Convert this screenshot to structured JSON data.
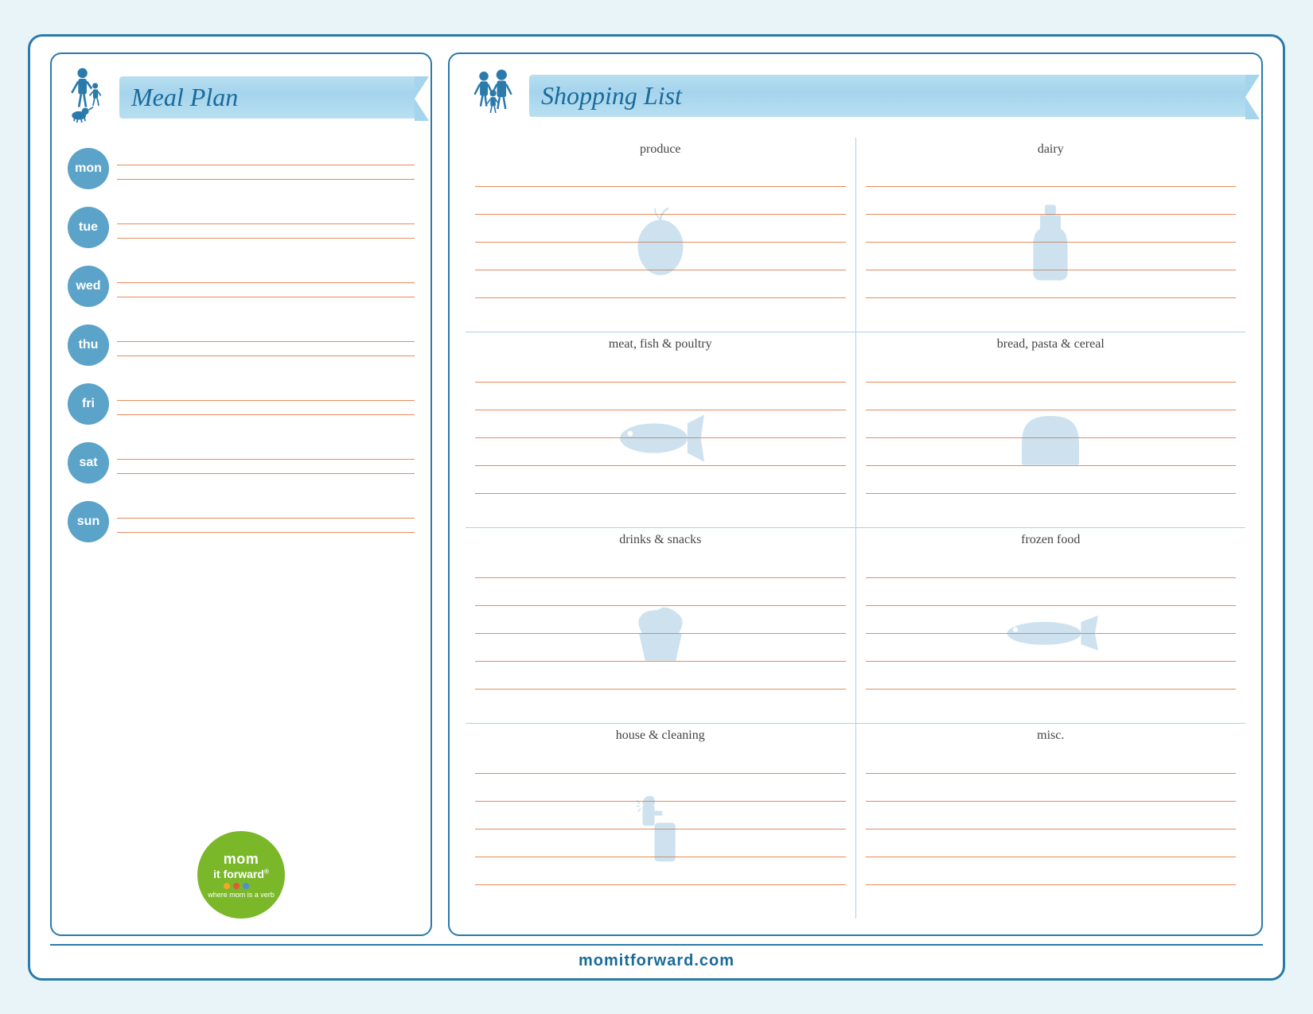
{
  "page": {
    "background_color": "#e8f4f8",
    "border_color": "#2a7aab"
  },
  "meal_plan": {
    "title": "Meal Plan",
    "days": [
      {
        "label": "mon"
      },
      {
        "label": "tue"
      },
      {
        "label": "wed"
      },
      {
        "label": "thu"
      },
      {
        "label": "fri"
      },
      {
        "label": "sat"
      },
      {
        "label": "sun"
      }
    ]
  },
  "shopping_list": {
    "title": "Shopping List",
    "categories": [
      {
        "id": "produce",
        "label": "produce",
        "icon": "apple"
      },
      {
        "id": "dairy",
        "label": "dairy",
        "icon": "bottle"
      },
      {
        "id": "meat",
        "label": "meat, fish & poultry",
        "icon": "fish"
      },
      {
        "id": "bread",
        "label": "bread, pasta & cereal",
        "icon": "bread"
      },
      {
        "id": "drinks",
        "label": "drinks & snacks",
        "icon": "cupcake"
      },
      {
        "id": "frozen",
        "label": "frozen food",
        "icon": "fish-flat"
      },
      {
        "id": "house",
        "label": "house & cleaning",
        "icon": "spray"
      },
      {
        "id": "misc",
        "label": "misc.",
        "icon": "bottle-clean"
      }
    ]
  },
  "footer": {
    "website": "momitforward.com"
  },
  "logo": {
    "line1": "mom",
    "line2": "it forward",
    "registered": "®",
    "tagline": "where mom is a verb",
    "dots": [
      "#f5a623",
      "#e05a3a",
      "#4a90d9",
      "#7ab829"
    ]
  }
}
